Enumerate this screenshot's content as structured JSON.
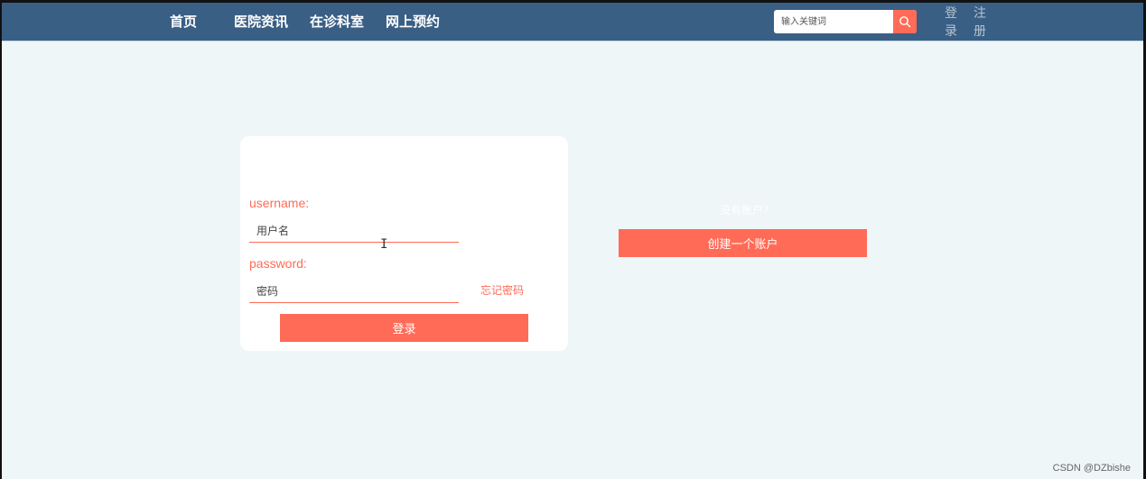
{
  "colors": {
    "navbar": "#3a5f85",
    "accent": "#ff6b57",
    "background": "#eef6f8",
    "card": "#ffffff"
  },
  "navbar": {
    "items": [
      {
        "label": "首页"
      },
      {
        "label": "医院资讯"
      },
      {
        "label": "在诊科室"
      },
      {
        "label": "网上预约"
      }
    ],
    "search": {
      "placeholder": "输入关键词",
      "icon": "search-icon"
    },
    "login_link": "登录",
    "register_link": "注册"
  },
  "login_form": {
    "username_label": "username:",
    "username_placeholder": "用户名",
    "password_label": "password:",
    "password_placeholder": "密码",
    "forgot_password": "忘记密码",
    "submit_label": "登录"
  },
  "signup": {
    "prompt": "没有账户?",
    "button_label": "创建一个账户"
  },
  "watermark": "CSDN @DZbishe"
}
